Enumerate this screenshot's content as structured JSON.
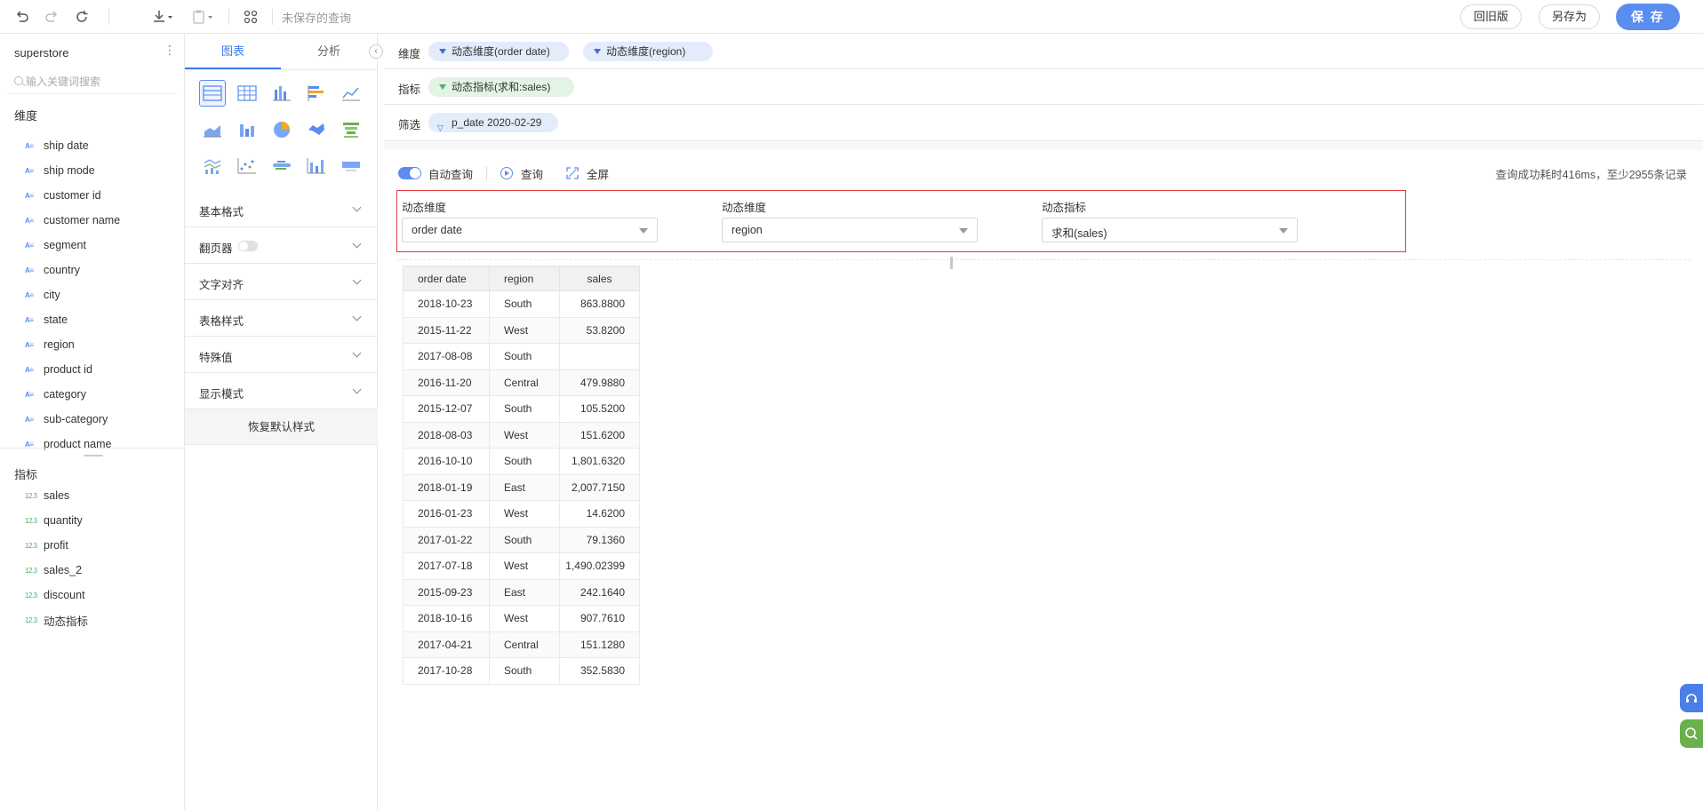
{
  "toolbar": {
    "query_title": "未保存的查询",
    "revert_label": "回旧版",
    "save_as_label": "另存为",
    "save_label": "保 存"
  },
  "fields_panel": {
    "dataset_name": "superstore",
    "search_placeholder": "输入关键词搜索",
    "dimensions_title": "维度",
    "dimensions": [
      "ship date",
      "ship mode",
      "customer id",
      "customer name",
      "segment",
      "country",
      "city",
      "state",
      "region",
      "product id",
      "category",
      "sub-category",
      "product name"
    ],
    "measures_title": "指标",
    "measures": [
      "sales",
      "quantity",
      "profit",
      "sales_2",
      "discount",
      "动态指标"
    ],
    "dim_icon": "A≡",
    "measure_icon": "12.3"
  },
  "config_panel": {
    "tabs": [
      "图表",
      "分析"
    ],
    "active_tab": "图表",
    "sections": [
      "基本格式",
      "翻页器",
      "文字对齐",
      "表格样式",
      "特殊值",
      "显示模式"
    ],
    "reset_label": "恢复默认样式"
  },
  "shelves": {
    "dimensions_label": "维度",
    "dimension_pills": [
      "动态维度(order date)",
      "动态维度(region)"
    ],
    "measures_label": "指标",
    "measure_pills": [
      "动态指标(求和:sales)"
    ],
    "filter_label": "筛选",
    "filter_pills": [
      "p_date 2020-02-29"
    ]
  },
  "query_bar": {
    "auto_query_label": "自动查询",
    "auto_query_on": true,
    "query_label": "查询",
    "fullscreen_label": "全屏",
    "status": "查询成功耗时416ms，至少2955条记录"
  },
  "dynamic_params": [
    {
      "label": "动态维度",
      "value": "order date"
    },
    {
      "label": "动态维度",
      "value": "region"
    },
    {
      "label": "动态指标",
      "value": "求和(sales)"
    }
  ],
  "table": {
    "columns": [
      "order date",
      "region",
      "sales"
    ],
    "rows": [
      [
        "2018-10-23",
        "South",
        "863.8800"
      ],
      [
        "2015-11-22",
        "West",
        "53.8200"
      ],
      [
        "2017-08-08",
        "South",
        ""
      ],
      [
        "2016-11-20",
        "Central",
        "479.9880"
      ],
      [
        "2015-12-07",
        "South",
        "105.5200"
      ],
      [
        "2018-08-03",
        "West",
        "151.6200"
      ],
      [
        "2016-10-10",
        "South",
        "1,801.6320"
      ],
      [
        "2018-01-19",
        "East",
        "2,007.7150"
      ],
      [
        "2016-01-23",
        "West",
        "14.6200"
      ],
      [
        "2017-01-22",
        "South",
        "79.1360"
      ],
      [
        "2017-07-18",
        "West",
        "1,490.02399"
      ],
      [
        "2015-09-23",
        "East",
        "242.1640"
      ],
      [
        "2018-10-16",
        "West",
        "907.7610"
      ],
      [
        "2017-04-21",
        "Central",
        "151.1280"
      ],
      [
        "2017-10-28",
        "South",
        "352.5830"
      ]
    ]
  },
  "colors": {
    "accent": "#5b8def",
    "highlight_border": "#e23c3c",
    "dimension_pill": "#e3ecfb",
    "measure_pill": "#e3f3e5",
    "float_support": "#4a7ee8",
    "float_search": "#6ab04c"
  }
}
